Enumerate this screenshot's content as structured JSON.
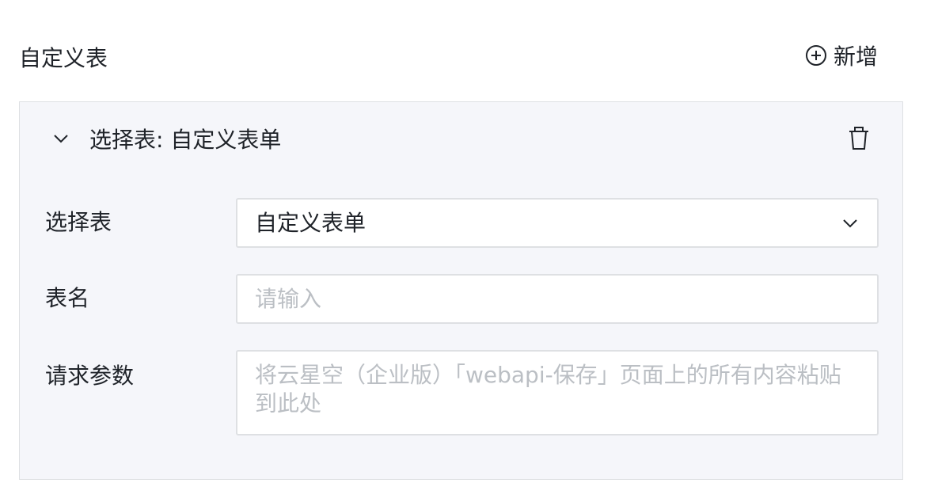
{
  "section": {
    "title": "自定义表",
    "add_label": "新增"
  },
  "card": {
    "title": "选择表: 自定义表单",
    "fields": {
      "select_table": {
        "label": "选择表",
        "value": "自定义表单"
      },
      "table_name": {
        "label": "表名",
        "placeholder": "请输入"
      },
      "request_params": {
        "label": "请求参数",
        "placeholder": "将云星空（企业版）「webapi-保存」页面上的所有内容粘贴到此处"
      }
    }
  },
  "icons": {
    "add": "plus-circle-icon",
    "collapse": "chevron-down-icon",
    "delete": "trash-icon",
    "select": "chevron-down-icon"
  },
  "colors": {
    "text": "#1f2329",
    "placeholder": "#bbbfc4",
    "card_bg": "#f5f6fa",
    "border": "#dee0e3"
  }
}
